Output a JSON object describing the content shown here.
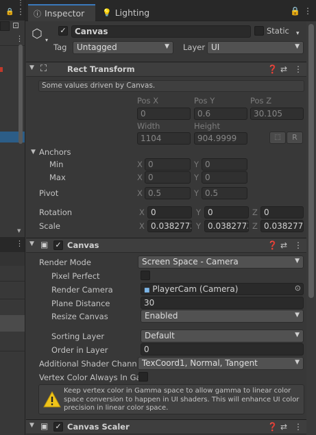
{
  "tabs": [
    {
      "label": "Inspector",
      "icon": "info-icon"
    },
    {
      "label": "Lighting",
      "icon": "bulb-icon"
    }
  ],
  "object": {
    "name": "Canvas",
    "static_label": "Static",
    "tag_label": "Tag",
    "tag_value": "Untagged",
    "layer_label": "Layer",
    "layer_value": "UI"
  },
  "rect_transform": {
    "title": "Rect Transform",
    "info": "Some values driven by Canvas.",
    "pos_x_label": "Pos X",
    "pos_y_label": "Pos Y",
    "pos_z_label": "Pos Z",
    "pos_x": "0",
    "pos_y": "0.6",
    "pos_z": "30.105",
    "width_label": "Width",
    "height_label": "Height",
    "width": "1104",
    "height": "904.9999",
    "r_button": "R",
    "anchors_label": "Anchors",
    "min_label": "Min",
    "max_label": "Max",
    "min_x": "0",
    "min_y": "0",
    "max_x": "0",
    "max_y": "0",
    "pivot_label": "Pivot",
    "pivot_x": "0.5",
    "pivot_y": "0.5",
    "rotation_label": "Rotation",
    "rot_x": "0",
    "rot_y": "0",
    "rot_z": "0",
    "scale_label": "Scale",
    "scale_x": "0.0382773",
    "scale_y": "0.0382773",
    "scale_z": "0.0382773",
    "axis_x": "X",
    "axis_y": "Y",
    "axis_z": "Z"
  },
  "canvas": {
    "title": "Canvas",
    "render_mode_label": "Render Mode",
    "render_mode": "Screen Space - Camera",
    "pixel_perfect_label": "Pixel Perfect",
    "render_camera_label": "Render Camera",
    "render_camera": "PlayerCam (Camera)",
    "plane_distance_label": "Plane Distance",
    "plane_distance": "30",
    "resize_canvas_label": "Resize Canvas",
    "resize_canvas": "Enabled",
    "sorting_layer_label": "Sorting Layer",
    "sorting_layer": "Default",
    "order_in_layer_label": "Order in Layer",
    "order_in_layer": "0",
    "shader_channels_label": "Additional Shader Channe",
    "shader_channels": "TexCoord1, Normal, Tangent",
    "vertex_color_label": "Vertex Color Always In Ga",
    "warning": "Keep vertex color in Gamma space to allow gamma to linear color space conversion to happen in UI shaders. This will enhance UI color precision in linear color space."
  },
  "canvas_scaler": {
    "title": "Canvas Scaler"
  },
  "colors": {
    "accent": "#3a79bb",
    "panel": "#383838",
    "field": "#2a2a2a",
    "warning": "#f0c419"
  }
}
